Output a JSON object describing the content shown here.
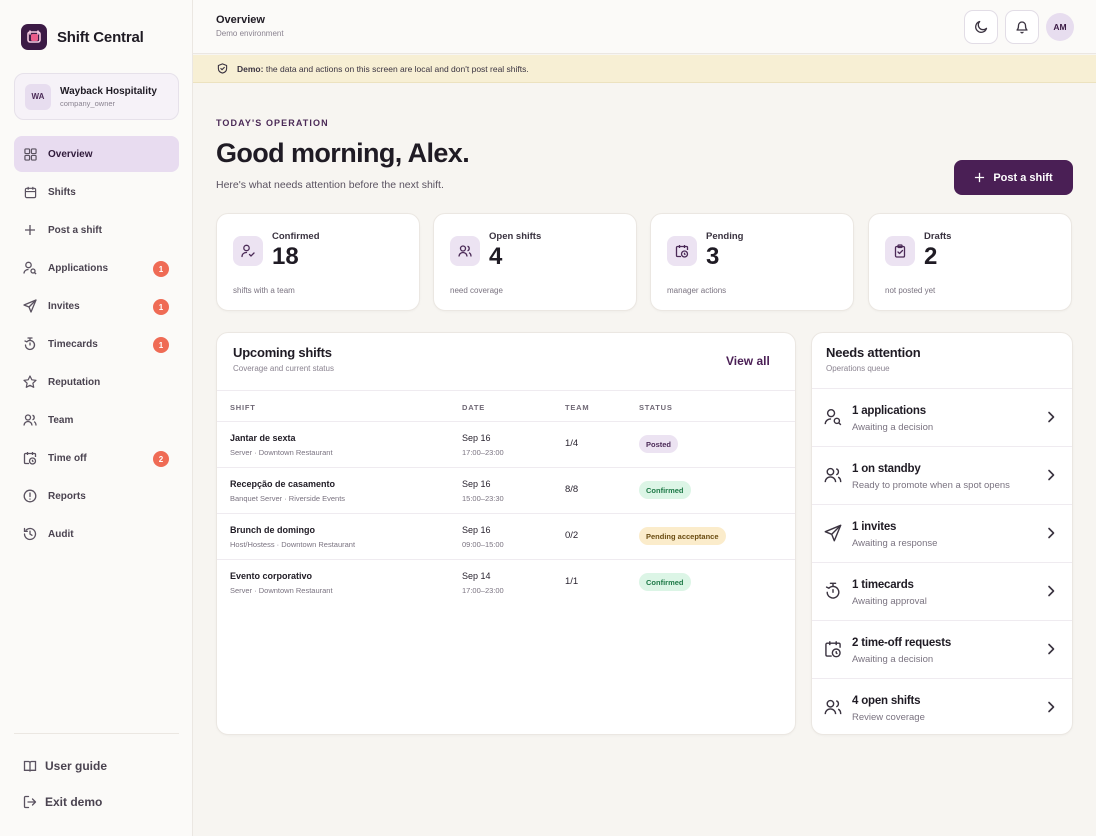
{
  "brand": {
    "name": "Shift Central"
  },
  "org": {
    "initials": "WA",
    "name": "Wayback Hospitality",
    "role": "company_owner"
  },
  "nav": [
    {
      "label": "Overview",
      "icon": "grid-icon",
      "active": true,
      "badge": ""
    },
    {
      "label": "Shifts",
      "icon": "calendar-icon",
      "badge": ""
    },
    {
      "label": "Post a shift",
      "icon": "plus-icon",
      "badge": ""
    },
    {
      "label": "Applications",
      "icon": "user-search-icon",
      "badge": "1"
    },
    {
      "label": "Invites",
      "icon": "send-icon",
      "badge": "1"
    },
    {
      "label": "Timecards",
      "icon": "timer-icon",
      "badge": "1"
    },
    {
      "label": "Reputation",
      "icon": "star-icon",
      "badge": ""
    },
    {
      "label": "Team",
      "icon": "users-icon",
      "badge": ""
    },
    {
      "label": "Time off",
      "icon": "calendar-clock-icon",
      "badge": "2"
    },
    {
      "label": "Reports",
      "icon": "alert-circle-icon",
      "badge": ""
    },
    {
      "label": "Audit",
      "icon": "history-icon",
      "badge": ""
    }
  ],
  "footer": {
    "guide": "User guide",
    "exit": "Exit demo"
  },
  "header": {
    "title": "Overview",
    "subtitle": "Demo environment",
    "avatar_initials": "AM"
  },
  "banner": {
    "strong": "Demo:",
    "text": "the data and actions on this screen are local and don't post real shifts."
  },
  "hero": {
    "eyebrow": "TODAY'S OPERATION",
    "greeting": "Good morning, Alex.",
    "lead": "Here's what needs attention before the next shift.",
    "post_button": "Post a shift"
  },
  "stats": [
    {
      "label": "Confirmed",
      "value": "18",
      "note": "shifts with a team",
      "icon": "user-check-icon"
    },
    {
      "label": "Open shifts",
      "value": "4",
      "note": "need coverage",
      "icon": "users-icon"
    },
    {
      "label": "Pending",
      "value": "3",
      "note": "manager actions",
      "icon": "calendar-clock-icon"
    },
    {
      "label": "Drafts",
      "value": "2",
      "note": "not posted yet",
      "icon": "clipboard-icon"
    }
  ],
  "upcoming": {
    "title": "Upcoming shifts",
    "subtitle": "Coverage and current status",
    "view_all": "View all",
    "columns": [
      "SHIFT",
      "DATE",
      "TEAM",
      "STATUS"
    ],
    "rows": [
      {
        "name": "Jantar de sexta",
        "role": "Server · Downtown Restaurant",
        "date": "Sep 16",
        "time": "17:00–23:00",
        "team": "1/4",
        "status": "Posted",
        "status_color": "#ece3f2",
        "status_text_color": "#4b2a57"
      },
      {
        "name": "Recepção de casamento",
        "role": "Banquet Server · Riverside Events",
        "date": "Sep 16",
        "time": "15:00–23:30",
        "team": "8/8",
        "status": "Confirmed",
        "status_color": "#dcf5e6",
        "status_text_color": "#1f7a48"
      },
      {
        "name": "Brunch de domingo",
        "role": "Host/Hostess · Downtown Restaurant",
        "date": "Sep 16",
        "time": "09:00–15:00",
        "team": "0/2",
        "status": "Pending acceptance",
        "status_color": "#fbeccb",
        "status_text_color": "#6b4d12"
      },
      {
        "name": "Evento corporativo",
        "role": "Server · Downtown Restaurant",
        "date": "Sep 14",
        "time": "17:00–23:00",
        "team": "1/1",
        "status": "Confirmed",
        "status_color": "#dcf5e6",
        "status_text_color": "#1f7a48"
      }
    ]
  },
  "attention": {
    "title": "Needs attention",
    "subtitle": "Operations queue",
    "items": [
      {
        "title": "1 applications",
        "sub": "Awaiting a decision",
        "icon": "user-search-icon"
      },
      {
        "title": "1 on standby",
        "sub": "Ready to promote when a spot opens",
        "icon": "users-icon"
      },
      {
        "title": "1 invites",
        "sub": "Awaiting a response",
        "icon": "send-icon"
      },
      {
        "title": "1 timecards",
        "sub": "Awaiting approval",
        "icon": "timer-icon"
      },
      {
        "title": "2 time-off requests",
        "sub": "Awaiting a decision",
        "icon": "calendar-clock-icon"
      },
      {
        "title": "4 open shifts",
        "sub": "Review coverage",
        "icon": "users-icon"
      }
    ]
  },
  "colors": {
    "accent": "#4a1f55",
    "badge": "#ef6b55",
    "active_nav": "#e8dcf0",
    "banner": "#f7efd4"
  }
}
